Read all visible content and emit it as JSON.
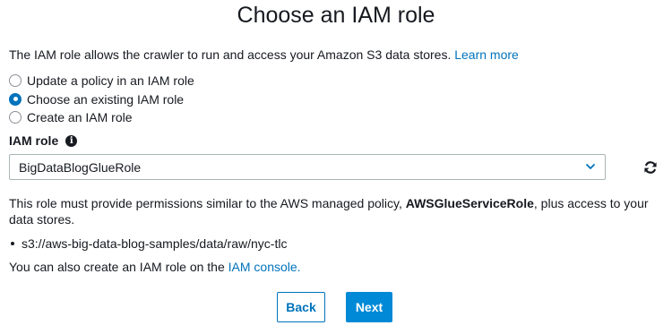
{
  "title": "Choose an IAM role",
  "intro": {
    "text": "The IAM role allows the crawler to run and access your Amazon S3 data stores. ",
    "link": "Learn more"
  },
  "radio_options": [
    {
      "label": "Update a policy in an IAM role",
      "checked": false
    },
    {
      "label": "Choose an existing IAM role",
      "checked": true
    },
    {
      "label": "Create an IAM role",
      "checked": false
    }
  ],
  "iam_role": {
    "label": "IAM role",
    "value": "BigDataBlogGlueRole"
  },
  "permissions": {
    "prefix": "This role must provide permissions similar to the AWS managed policy, ",
    "policy": "AWSGlueServiceRole",
    "suffix": ", plus access to your data stores."
  },
  "data_stores": [
    "s3://aws-big-data-blog-samples/data/raw/nyc-tlc"
  ],
  "console_note": {
    "text": "You can also create an IAM role on the ",
    "link": "IAM console."
  },
  "buttons": {
    "back": "Back",
    "next": "Next"
  },
  "colors": {
    "accent": "#0073bb",
    "primary_button": "#0089d6",
    "text": "#16191f"
  },
  "icons": {
    "info": "info-icon",
    "chevron": "chevron-down-icon",
    "refresh": "refresh-icon"
  }
}
